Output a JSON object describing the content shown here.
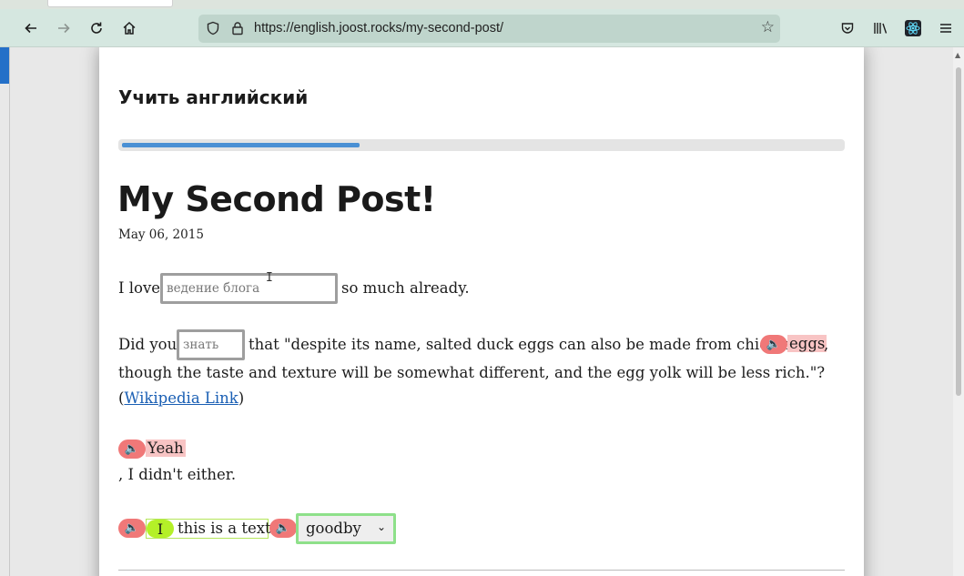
{
  "browser": {
    "url": "https://english.joost.rocks/my-second-post/",
    "icons": {
      "back": "arrow-left-icon",
      "forward": "arrow-right-icon",
      "reload": "reload-icon",
      "home": "home-icon",
      "shield": "shield-icon",
      "lock": "lock-icon",
      "bookmark": "star-icon",
      "pocket": "pocket-icon",
      "library": "library-icon",
      "extension": "react-devtools-icon",
      "menu": "hamburger-menu-icon"
    }
  },
  "page": {
    "site_title": "Учить английский",
    "reading_progress": 0.33,
    "post": {
      "title": "My Second Post!",
      "date": "May 06, 2015",
      "p1": {
        "before": "I love",
        "placeholder": "ведение блога",
        "after": "so much already."
      },
      "p2": {
        "before": "Did you",
        "placeholder": "знать",
        "middle": "that \"despite its name, salted duck eggs can also be made from chicken",
        "highlighted_word": "eggs",
        "comma": ",",
        "line2": "though the taste and texture will be somewhat different, and the egg yolk will be less rich.\"?",
        "paren_open": "(",
        "link_text": "Wikipedia Link",
        "paren_close": ")"
      },
      "p3": {
        "highlighted_word": "Yeah",
        "line2": ", I didn't either."
      },
      "p4": {
        "pill_word": "I",
        "text": "this is a text",
        "select_value": "goodby"
      }
    }
  },
  "colors": {
    "audio_badge": "#f07878",
    "highlight": "#f8c4c4",
    "progress": "#4a90d4",
    "green_pill": "#b4f028",
    "select_border": "#8ee08a"
  }
}
